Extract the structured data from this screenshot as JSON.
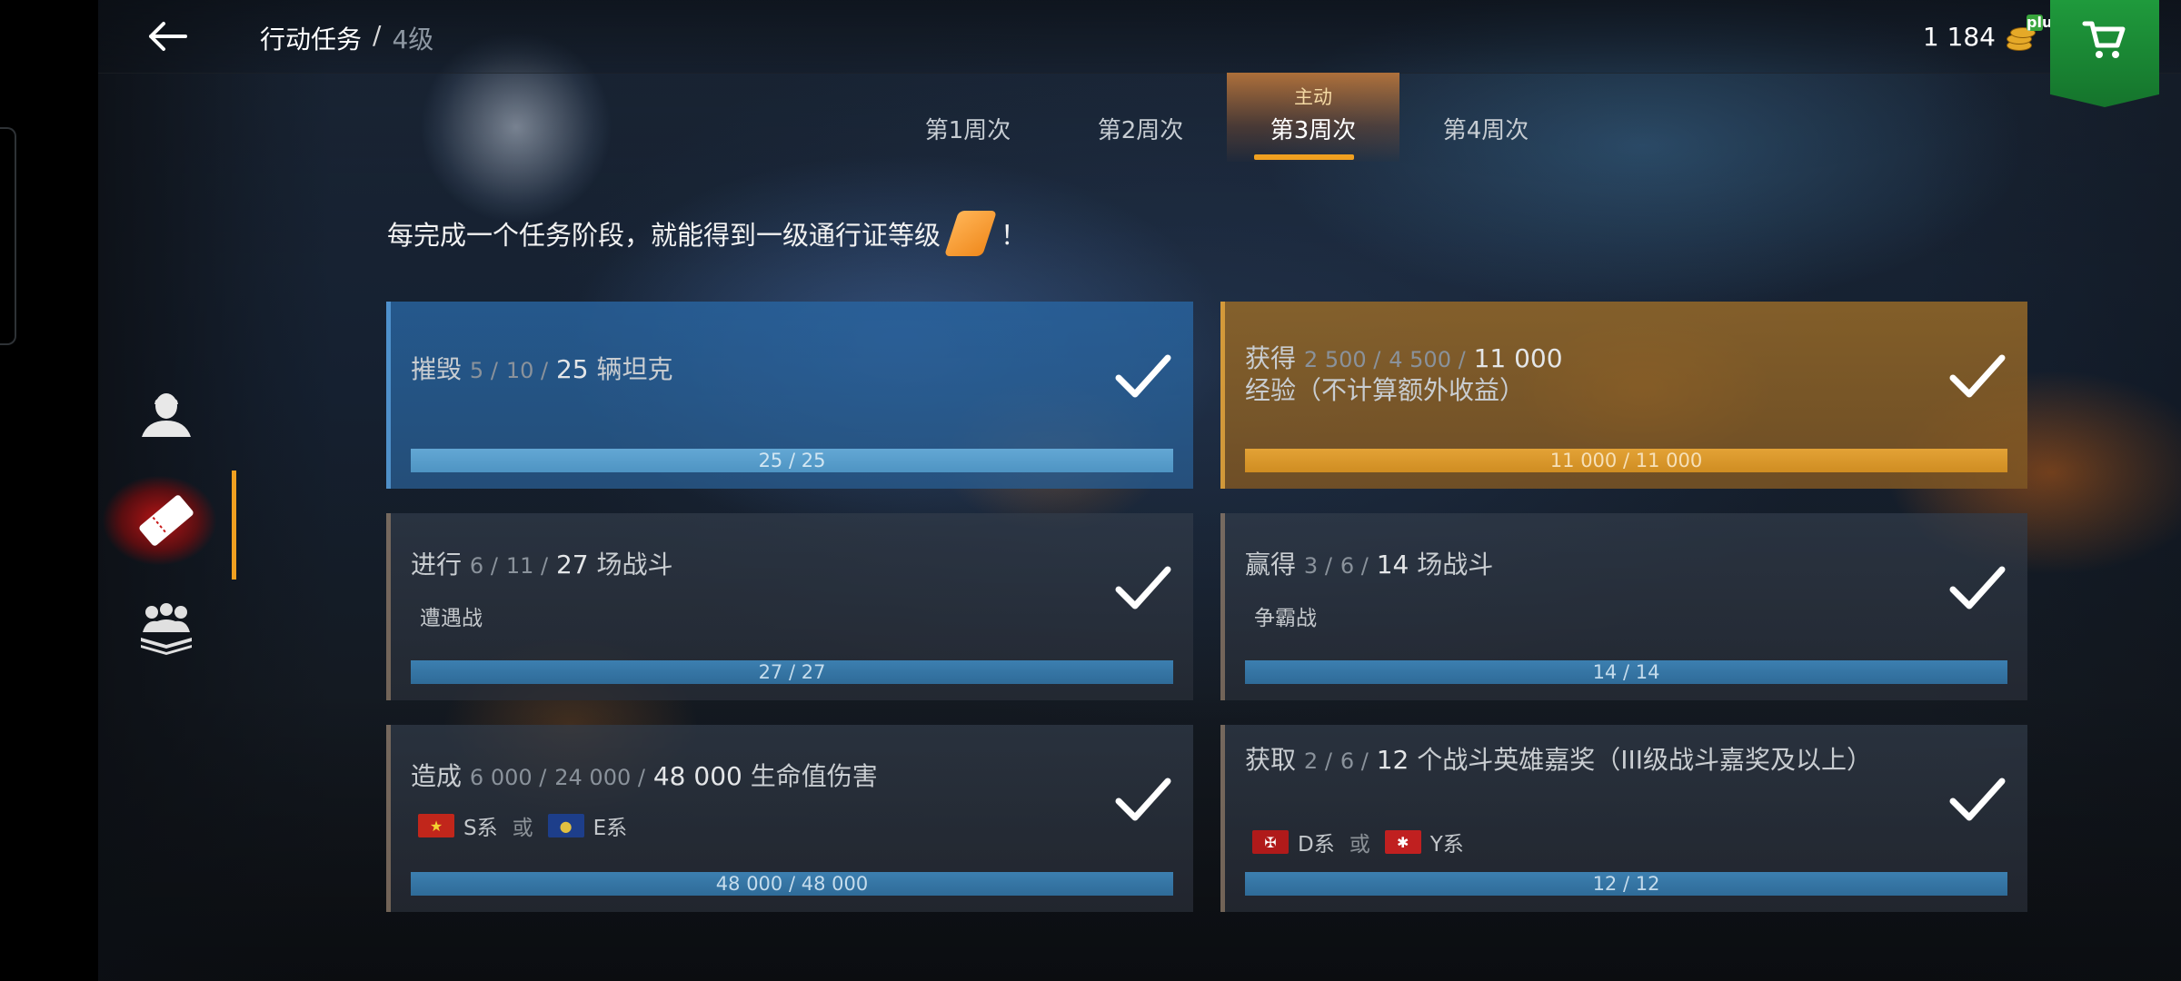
{
  "header": {
    "title": "行动任务",
    "separator": "/",
    "level": "4级",
    "coins": "1 184"
  },
  "icons": {
    "back": "arrow-left-icon",
    "coins": "gold-coins-icon",
    "coins_add": "plus",
    "shop": "cart-icon",
    "sidebar": [
      "soldier-profile-icon",
      "pass-ticket-icon",
      "crew-icon"
    ],
    "complete": "checkmark-icon"
  },
  "weeks": [
    {
      "label": "第1周次",
      "tag": ""
    },
    {
      "label": "第2周次",
      "tag": ""
    },
    {
      "label": "第3周次",
      "tag": "主动",
      "active": true
    },
    {
      "label": "第4周次",
      "tag": ""
    }
  ],
  "info": {
    "text": "每完成一个任务阶段，就能得到一级通行证等级",
    "suffix": "！"
  },
  "tasks": [
    {
      "verb": "摧毁",
      "stage1": "5 /",
      "stage2": "10 /",
      "target": "25",
      "object": "辆坦克",
      "progress_text": "25 / 25",
      "progress": 1.0,
      "complete": true
    },
    {
      "verb": "获得",
      "stage1": "2 500 /",
      "stage2": "4 500 /",
      "target": "11 000",
      "object": "经验（不计算额外收益）",
      "progress_text": "11 000 / 11 000",
      "progress": 1.0,
      "complete": true
    },
    {
      "verb": "进行",
      "stage1": "6 /",
      "stage2": "11 /",
      "target": "27",
      "object": "场战斗",
      "mode": "遭遇战",
      "progress_text": "27 / 27",
      "progress": 1.0,
      "complete": true
    },
    {
      "verb": "赢得",
      "stage1": "3 /",
      "stage2": "6 /",
      "target": "14",
      "object": "场战斗",
      "mode": "争霸战",
      "progress_text": "14 / 14",
      "progress": 1.0,
      "complete": true
    },
    {
      "verb": "造成",
      "stage1": "6 000 /",
      "stage2": "24 000 /",
      "target": "48 000",
      "object": "生命值伤害",
      "nation1": "S系",
      "or": "或",
      "nation2": "E系",
      "progress_text": "48 000 / 48 000",
      "progress": 1.0,
      "complete": true
    },
    {
      "verb": "获取",
      "stage1": "2 /",
      "stage2": "6 /",
      "target": "12",
      "object": "个战斗英雄嘉奖（III级战斗嘉奖及以上）",
      "nation1": "D系",
      "or": "或",
      "nation2": "Y系",
      "progress_text": "12 / 12",
      "progress": 1.0,
      "complete": true
    }
  ]
}
